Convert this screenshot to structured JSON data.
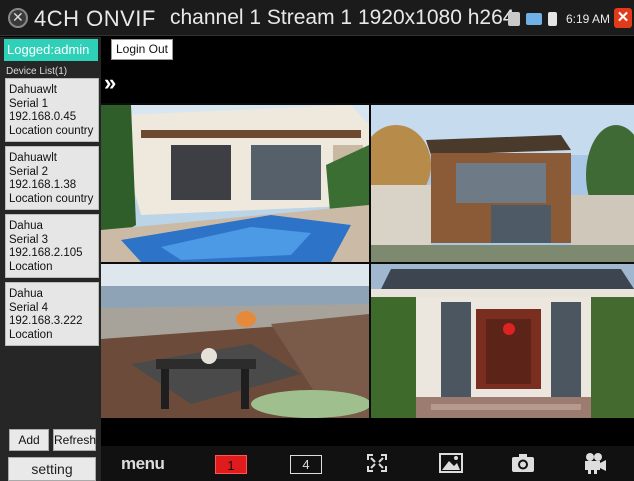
{
  "titlebar": {
    "app_title": "4CH ONVIF",
    "stream_title": "channel 1 Stream 1 1920x1080 h264",
    "clock": "6:19 AM",
    "close_label": "✕"
  },
  "sidebar": {
    "logged_in": "Logged:admin",
    "device_list_label": "Device List(1)",
    "devices": [
      {
        "name": "Dahuawlt",
        "serial": "Serial 1",
        "ip": "192.168.0.45",
        "location": "Location country"
      },
      {
        "name": "Dahuawlt",
        "serial": "Serial 2",
        "ip": "192.168.1.38",
        "location": "Location country"
      },
      {
        "name": "Dahua",
        "serial": "Serial 3",
        "ip": "192.168.2.105",
        "location": "Location"
      },
      {
        "name": "Dahua",
        "serial": "Serial 4",
        "ip": "192.168.3.222",
        "location": "Location"
      }
    ],
    "add_label": "Add",
    "refresh_label": "Refresh",
    "setting_label": "setting"
  },
  "controls": {
    "login_out_label": "Login Out",
    "expand_label": "»"
  },
  "toolbar": {
    "menu_label": "menu",
    "layout_1_label": "1",
    "layout_4_label": "4"
  },
  "icons": {
    "app": "onvif-logo-icon",
    "fullscreen": "fullscreen-icon",
    "picture": "picture-icon",
    "snapshot": "camera-icon",
    "record": "video-record-icon"
  },
  "colors": {
    "accent_logged": "#2fd0b8",
    "active_layout": "#e01b1b",
    "close_button": "#e23b1c"
  }
}
